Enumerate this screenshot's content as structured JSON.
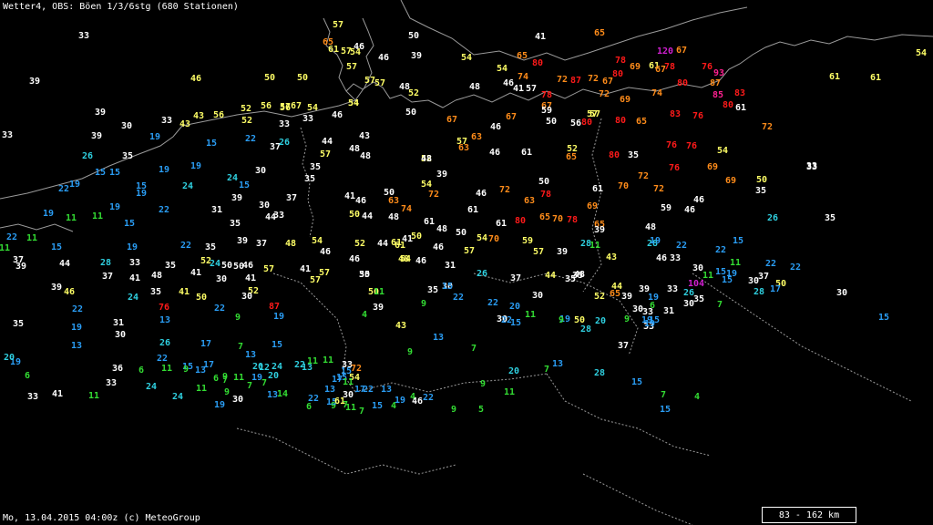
{
  "header": {
    "title": "Wetter4, OBS: Böen 1/3/6stg (680 Stationen)"
  },
  "footer": {
    "text": "Mo, 13.04.2015 04:00z (c) MeteoGroup",
    "scale_label": "83 - 162 km"
  },
  "colors": {
    "background": "#000000",
    "coastline": "#9a9a9a",
    "gust_4_11": "#33dd33",
    "gust_12_22": "#2a9df4",
    "gust_23_28": "#2fd0e0",
    "gust_29_41": "#ffffff",
    "gust_42_57": "#ffff66",
    "gust_58_74": "#ff8c1a",
    "gust_75_90": "#ff1a1a",
    "gust_91_110": "#ff2090",
    "gust_over_110": "#d020d0"
  },
  "stations": [
    {
      "v": "33",
      "c": "w"
    },
    {
      "v": "39",
      "c": "w"
    },
    {
      "v": "46",
      "c": "y"
    },
    {
      "v": "50",
      "c": "y"
    },
    {
      "v": "50",
      "c": "y"
    },
    {
      "v": "57",
      "c": "y"
    },
    {
      "v": "65",
      "c": "o"
    },
    {
      "v": "61",
      "c": "y"
    },
    {
      "v": "57",
      "c": "y"
    },
    {
      "v": "54",
      "c": "y"
    },
    {
      "v": "46",
      "c": "w"
    },
    {
      "v": "46",
      "c": "w"
    },
    {
      "v": "50",
      "c": "w"
    },
    {
      "v": "39",
      "c": "w"
    },
    {
      "v": "41",
      "c": "w"
    },
    {
      "v": "65",
      "c": "o"
    },
    {
      "v": "54",
      "c": "y"
    },
    {
      "v": "57",
      "c": "y"
    },
    {
      "v": "54",
      "c": "y"
    },
    {
      "v": "65",
      "c": "o"
    },
    {
      "v": "80",
      "c": "r"
    },
    {
      "v": "54",
      "c": "y"
    },
    {
      "v": "120",
      "c": "p"
    },
    {
      "v": "67",
      "c": "o"
    },
    {
      "v": "78",
      "c": "r"
    },
    {
      "v": "61",
      "c": "y"
    },
    {
      "v": "57",
      "c": "y"
    },
    {
      "v": "57",
      "c": "y"
    },
    {
      "v": "54",
      "c": "y"
    },
    {
      "v": "48",
      "c": "w"
    },
    {
      "v": "52",
      "c": "y"
    },
    {
      "v": "48",
      "c": "w"
    },
    {
      "v": "46",
      "c": "w"
    },
    {
      "v": "41",
      "c": "w"
    },
    {
      "v": "57",
      "c": "w"
    },
    {
      "v": "74",
      "c": "o"
    },
    {
      "v": "72",
      "c": "o"
    },
    {
      "v": "87",
      "c": "r"
    },
    {
      "v": "72",
      "c": "o"
    },
    {
      "v": "67",
      "c": "o"
    },
    {
      "v": "80",
      "c": "r"
    },
    {
      "v": "69",
      "c": "o"
    },
    {
      "v": "78",
      "c": "r"
    },
    {
      "v": "67",
      "c": "o"
    },
    {
      "v": "76",
      "c": "r"
    },
    {
      "v": "93",
      "c": "m"
    },
    {
      "v": "87",
      "c": "o"
    },
    {
      "v": "80",
      "c": "r"
    },
    {
      "v": "61",
      "c": "y"
    },
    {
      "v": "61",
      "c": "y"
    },
    {
      "v": "57",
      "c": "y"
    },
    {
      "v": "78",
      "c": "r"
    },
    {
      "v": "67",
      "c": "o"
    },
    {
      "v": "59",
      "c": "w"
    },
    {
      "v": "72",
      "c": "o"
    },
    {
      "v": "69",
      "c": "o"
    },
    {
      "v": "74",
      "c": "o"
    },
    {
      "v": "85",
      "c": "m"
    },
    {
      "v": "83",
      "c": "r"
    },
    {
      "v": "80",
      "c": "r"
    },
    {
      "v": "61",
      "c": "w"
    },
    {
      "v": "39",
      "c": "w"
    },
    {
      "v": "33",
      "c": "w"
    },
    {
      "v": "43",
      "c": "y"
    },
    {
      "v": "56",
      "c": "y"
    },
    {
      "v": "52",
      "c": "y"
    },
    {
      "v": "56",
      "c": "y"
    },
    {
      "v": "57",
      "c": "y"
    },
    {
      "v": "67",
      "c": "y"
    },
    {
      "v": "54",
      "c": "y"
    },
    {
      "v": "50",
      "c": "w"
    },
    {
      "v": "67",
      "c": "o"
    },
    {
      "v": "46",
      "c": "w"
    },
    {
      "v": "67",
      "c": "o"
    },
    {
      "v": "50",
      "c": "w"
    },
    {
      "v": "57",
      "c": "y"
    },
    {
      "v": "56",
      "c": "w"
    },
    {
      "v": "80",
      "c": "r"
    },
    {
      "v": "80",
      "c": "r"
    },
    {
      "v": "65",
      "c": "o"
    },
    {
      "v": "83",
      "c": "r"
    },
    {
      "v": "76",
      "c": "r"
    },
    {
      "v": "72",
      "c": "o"
    },
    {
      "v": "33",
      "c": "w"
    },
    {
      "v": "39",
      "c": "w"
    },
    {
      "v": "43",
      "c": "y"
    },
    {
      "v": "52",
      "c": "y"
    },
    {
      "v": "33",
      "c": "w"
    },
    {
      "v": "56",
      "c": "y"
    },
    {
      "v": "46",
      "c": "w"
    },
    {
      "v": "54",
      "c": "y"
    },
    {
      "v": "33",
      "c": "w"
    },
    {
      "v": "30",
      "c": "w"
    },
    {
      "v": "19",
      "c": "b"
    },
    {
      "v": "15",
      "c": "b"
    },
    {
      "v": "22",
      "c": "b"
    },
    {
      "v": "37",
      "c": "w"
    },
    {
      "v": "26",
      "c": "c"
    },
    {
      "v": "43",
      "c": "w"
    },
    {
      "v": "44",
      "c": "w"
    },
    {
      "v": "57",
      "c": "y"
    },
    {
      "v": "48",
      "c": "w"
    },
    {
      "v": "52",
      "c": "y"
    },
    {
      "v": "48",
      "c": "w"
    },
    {
      "v": "57",
      "c": "y"
    },
    {
      "v": "63",
      "c": "o"
    },
    {
      "v": "46",
      "c": "w"
    },
    {
      "v": "61",
      "c": "w"
    },
    {
      "v": "52",
      "c": "y"
    },
    {
      "v": "65",
      "c": "o"
    },
    {
      "v": "80",
      "c": "r"
    },
    {
      "v": "35",
      "c": "w"
    },
    {
      "v": "76",
      "c": "r"
    },
    {
      "v": "76",
      "c": "r"
    },
    {
      "v": "54",
      "c": "y"
    },
    {
      "v": "69",
      "c": "o"
    },
    {
      "v": "33",
      "c": "w"
    },
    {
      "v": "26",
      "c": "c"
    },
    {
      "v": "15",
      "c": "b"
    },
    {
      "v": "15",
      "c": "b"
    },
    {
      "v": "35",
      "c": "w"
    },
    {
      "v": "19",
      "c": "b"
    },
    {
      "v": "19",
      "c": "b"
    },
    {
      "v": "24",
      "c": "c"
    },
    {
      "v": "30",
      "c": "w"
    },
    {
      "v": "35",
      "c": "w"
    },
    {
      "v": "48",
      "c": "w"
    },
    {
      "v": "39",
      "c": "w"
    },
    {
      "v": "63",
      "c": "o"
    },
    {
      "v": "50",
      "c": "w"
    },
    {
      "v": "61",
      "c": "w"
    },
    {
      "v": "70",
      "c": "o"
    },
    {
      "v": "72",
      "c": "o"
    },
    {
      "v": "72",
      "c": "o"
    },
    {
      "v": "76",
      "c": "r"
    },
    {
      "v": "46",
      "c": "w"
    },
    {
      "v": "69",
      "c": "o"
    },
    {
      "v": "50",
      "c": "y"
    },
    {
      "v": "35",
      "c": "w"
    },
    {
      "v": "33",
      "c": "w"
    },
    {
      "v": "22",
      "c": "b"
    },
    {
      "v": "19",
      "c": "b"
    },
    {
      "v": "15",
      "c": "b"
    },
    {
      "v": "24",
      "c": "c"
    },
    {
      "v": "15",
      "c": "b"
    },
    {
      "v": "19",
      "c": "b"
    },
    {
      "v": "39",
      "c": "w"
    },
    {
      "v": "30",
      "c": "w"
    },
    {
      "v": "37",
      "c": "w"
    },
    {
      "v": "35",
      "c": "w"
    },
    {
      "v": "41",
      "c": "w"
    },
    {
      "v": "46",
      "c": "w"
    },
    {
      "v": "50",
      "c": "w"
    },
    {
      "v": "63",
      "c": "o"
    },
    {
      "v": "54",
      "c": "y"
    },
    {
      "v": "72",
      "c": "o"
    },
    {
      "v": "46",
      "c": "w"
    },
    {
      "v": "72",
      "c": "o"
    },
    {
      "v": "63",
      "c": "o"
    },
    {
      "v": "78",
      "c": "r"
    },
    {
      "v": "65",
      "c": "o"
    },
    {
      "v": "61",
      "c": "w"
    },
    {
      "v": "69",
      "c": "o"
    },
    {
      "v": "59",
      "c": "w"
    },
    {
      "v": "46",
      "c": "w"
    },
    {
      "v": "26",
      "c": "c"
    },
    {
      "v": "19",
      "c": "b"
    },
    {
      "v": "11",
      "c": "g"
    },
    {
      "v": "11",
      "c": "g"
    },
    {
      "v": "19",
      "c": "b"
    },
    {
      "v": "15",
      "c": "b"
    },
    {
      "v": "22",
      "c": "b"
    },
    {
      "v": "31",
      "c": "w"
    },
    {
      "v": "35",
      "c": "w"
    },
    {
      "v": "33",
      "c": "w"
    },
    {
      "v": "44",
      "c": "w"
    },
    {
      "v": "50",
      "c": "y"
    },
    {
      "v": "44",
      "c": "w"
    },
    {
      "v": "48",
      "c": "w"
    },
    {
      "v": "74",
      "c": "o"
    },
    {
      "v": "41",
      "c": "w"
    },
    {
      "v": "61",
      "c": "y"
    },
    {
      "v": "50",
      "c": "y"
    },
    {
      "v": "61",
      "c": "w"
    },
    {
      "v": "80",
      "c": "r"
    },
    {
      "v": "61",
      "c": "w"
    },
    {
      "v": "70",
      "c": "o"
    },
    {
      "v": "78",
      "c": "r"
    },
    {
      "v": "65",
      "c": "o"
    },
    {
      "v": "48",
      "c": "w"
    },
    {
      "v": "28",
      "c": "c"
    },
    {
      "v": "35",
      "c": "w"
    },
    {
      "v": "11",
      "c": "g"
    },
    {
      "v": "22",
      "c": "b"
    },
    {
      "v": "11",
      "c": "g"
    },
    {
      "v": "15",
      "c": "b"
    },
    {
      "v": "19",
      "c": "b"
    },
    {
      "v": "22",
      "c": "b"
    },
    {
      "v": "35",
      "c": "w"
    },
    {
      "v": "39",
      "c": "w"
    },
    {
      "v": "37",
      "c": "w"
    },
    {
      "v": "48",
      "c": "y"
    },
    {
      "v": "54",
      "c": "y"
    },
    {
      "v": "46",
      "c": "w"
    },
    {
      "v": "52",
      "c": "y"
    },
    {
      "v": "44",
      "c": "w"
    },
    {
      "v": "61",
      "c": "y"
    },
    {
      "v": "54",
      "c": "y"
    },
    {
      "v": "46",
      "c": "w"
    },
    {
      "v": "48",
      "c": "w"
    },
    {
      "v": "50",
      "c": "w"
    },
    {
      "v": "57",
      "c": "y"
    },
    {
      "v": "70",
      "c": "o"
    },
    {
      "v": "54",
      "c": "y"
    },
    {
      "v": "59",
      "c": "y"
    },
    {
      "v": "57",
      "c": "y"
    },
    {
      "v": "39",
      "c": "w"
    },
    {
      "v": "28",
      "c": "c"
    },
    {
      "v": "39",
      "c": "w"
    },
    {
      "v": "11",
      "c": "g"
    },
    {
      "v": "19",
      "c": "b"
    },
    {
      "v": "22",
      "c": "b"
    },
    {
      "v": "22",
      "c": "b"
    },
    {
      "v": "15",
      "c": "b"
    },
    {
      "v": "37",
      "c": "w"
    },
    {
      "v": "39",
      "c": "w"
    },
    {
      "v": "44",
      "c": "w"
    },
    {
      "v": "28",
      "c": "c"
    },
    {
      "v": "33",
      "c": "w"
    },
    {
      "v": "35",
      "c": "w"
    },
    {
      "v": "52",
      "c": "y"
    },
    {
      "v": "50",
      "c": "w"
    },
    {
      "v": "46",
      "c": "w"
    },
    {
      "v": "57",
      "c": "y"
    },
    {
      "v": "41",
      "c": "w"
    },
    {
      "v": "57",
      "c": "y"
    },
    {
      "v": "46",
      "c": "w"
    },
    {
      "v": "35",
      "c": "w"
    },
    {
      "v": "48",
      "c": "y"
    },
    {
      "v": "31",
      "c": "w"
    },
    {
      "v": "46",
      "c": "w"
    },
    {
      "v": "44",
      "c": "y"
    },
    {
      "v": "35",
      "c": "w"
    },
    {
      "v": "43",
      "c": "y"
    },
    {
      "v": "46",
      "c": "w"
    },
    {
      "v": "33",
      "c": "w"
    },
    {
      "v": "30",
      "c": "w"
    },
    {
      "v": "11",
      "c": "g"
    },
    {
      "v": "15",
      "c": "b"
    },
    {
      "v": "11",
      "c": "g"
    },
    {
      "v": "22",
      "c": "b"
    },
    {
      "v": "22",
      "c": "b"
    },
    {
      "v": "37",
      "c": "w"
    },
    {
      "v": "39",
      "c": "w"
    },
    {
      "v": "41",
      "c": "w"
    },
    {
      "v": "48",
      "c": "w"
    },
    {
      "v": "41",
      "c": "w"
    },
    {
      "v": "24",
      "c": "c"
    },
    {
      "v": "50",
      "c": "w"
    },
    {
      "v": "30",
      "c": "w"
    },
    {
      "v": "41",
      "c": "w"
    },
    {
      "v": "57",
      "c": "y"
    },
    {
      "v": "50",
      "c": "w"
    },
    {
      "v": "35",
      "c": "w"
    },
    {
      "v": "50",
      "c": "y"
    },
    {
      "v": "30",
      "c": "w"
    },
    {
      "v": "26",
      "c": "c"
    },
    {
      "v": "37",
      "c": "w"
    },
    {
      "v": "48",
      "c": "w"
    },
    {
      "v": "35",
      "c": "w"
    },
    {
      "v": "44",
      "c": "y"
    },
    {
      "v": "39",
      "c": "w"
    },
    {
      "v": "33",
      "c": "w"
    },
    {
      "v": "26",
      "c": "c"
    },
    {
      "v": "104",
      "c": "p"
    },
    {
      "v": "19",
      "c": "b"
    },
    {
      "v": "15",
      "c": "b"
    },
    {
      "v": "30",
      "c": "w"
    },
    {
      "v": "37",
      "c": "w"
    },
    {
      "v": "30",
      "c": "w"
    },
    {
      "v": "46",
      "c": "y"
    },
    {
      "v": "24",
      "c": "c"
    },
    {
      "v": "35",
      "c": "w"
    },
    {
      "v": "41",
      "c": "y"
    },
    {
      "v": "50",
      "c": "y"
    },
    {
      "v": "52",
      "c": "y"
    },
    {
      "v": "30",
      "c": "w"
    },
    {
      "v": "11",
      "c": "g"
    },
    {
      "v": "15",
      "c": "b"
    },
    {
      "v": "22",
      "c": "b"
    },
    {
      "v": "20",
      "c": "b"
    },
    {
      "v": "30",
      "c": "w"
    },
    {
      "v": "52",
      "c": "y"
    },
    {
      "v": "65",
      "c": "o"
    },
    {
      "v": "39",
      "c": "w"
    },
    {
      "v": "19",
      "c": "b"
    },
    {
      "v": "30",
      "c": "w"
    },
    {
      "v": "31",
      "c": "w"
    },
    {
      "v": "30",
      "c": "w"
    },
    {
      "v": "35",
      "c": "w"
    },
    {
      "v": "28",
      "c": "c"
    },
    {
      "v": "50",
      "c": "y"
    },
    {
      "v": "17",
      "c": "b"
    },
    {
      "v": "7",
      "c": "g"
    },
    {
      "v": "15",
      "c": "b"
    },
    {
      "v": "22",
      "c": "b"
    },
    {
      "v": "35",
      "c": "w"
    },
    {
      "v": "76",
      "c": "r"
    },
    {
      "v": "22",
      "c": "b"
    },
    {
      "v": "87",
      "c": "r"
    },
    {
      "v": "39",
      "c": "w"
    },
    {
      "v": "9",
      "c": "g"
    },
    {
      "v": "22",
      "c": "b"
    },
    {
      "v": "30",
      "c": "w"
    },
    {
      "v": "15",
      "c": "b"
    },
    {
      "v": "11",
      "c": "g"
    },
    {
      "v": "19",
      "c": "b"
    },
    {
      "v": "20",
      "c": "c"
    },
    {
      "v": "28",
      "c": "c"
    },
    {
      "v": "33",
      "c": "w"
    },
    {
      "v": "33",
      "c": "w"
    },
    {
      "v": "19",
      "c": "b"
    },
    {
      "v": "31",
      "c": "w"
    },
    {
      "v": "13",
      "c": "b"
    },
    {
      "v": "9",
      "c": "g"
    },
    {
      "v": "19",
      "c": "b"
    },
    {
      "v": "4",
      "c": "g"
    },
    {
      "v": "43",
      "c": "y"
    },
    {
      "v": "22",
      "c": "b"
    },
    {
      "v": "9",
      "c": "g"
    },
    {
      "v": "50",
      "c": "y"
    },
    {
      "v": "19",
      "c": "b"
    },
    {
      "v": "15",
      "c": "b"
    },
    {
      "v": "9",
      "c": "g"
    },
    {
      "v": "6",
      "c": "g"
    },
    {
      "v": "19",
      "c": "b"
    },
    {
      "v": "13",
      "c": "b"
    },
    {
      "v": "30",
      "c": "w"
    },
    {
      "v": "26",
      "c": "c"
    },
    {
      "v": "17",
      "c": "b"
    },
    {
      "v": "7",
      "c": "g"
    },
    {
      "v": "15",
      "c": "b"
    },
    {
      "v": "13",
      "c": "b"
    },
    {
      "v": "7",
      "c": "g"
    },
    {
      "v": "37",
      "c": "w"
    },
    {
      "v": "19",
      "c": "b"
    },
    {
      "v": "20",
      "c": "c"
    },
    {
      "v": "22",
      "c": "b"
    },
    {
      "v": "15",
      "c": "b"
    },
    {
      "v": "13",
      "c": "b"
    },
    {
      "v": "20",
      "c": "c"
    },
    {
      "v": "12",
      "c": "c"
    },
    {
      "v": "24",
      "c": "c"
    },
    {
      "v": "22",
      "c": "c"
    },
    {
      "v": "13",
      "c": "c"
    },
    {
      "v": "11",
      "c": "g"
    },
    {
      "v": "11",
      "c": "g"
    },
    {
      "v": "33",
      "c": "w"
    },
    {
      "v": "72",
      "c": "o"
    },
    {
      "v": "54",
      "c": "y"
    },
    {
      "v": "9",
      "c": "g"
    },
    {
      "v": "20",
      "c": "c"
    },
    {
      "v": "7",
      "c": "g"
    },
    {
      "v": "13",
      "c": "b"
    },
    {
      "v": "28",
      "c": "c"
    },
    {
      "v": "36",
      "c": "w"
    },
    {
      "v": "6",
      "c": "g"
    },
    {
      "v": "11",
      "c": "g"
    },
    {
      "v": "9",
      "c": "g"
    },
    {
      "v": "13",
      "c": "b"
    },
    {
      "v": "17",
      "c": "b"
    },
    {
      "v": "6",
      "c": "g"
    },
    {
      "v": "9",
      "c": "g"
    },
    {
      "v": "11",
      "c": "g"
    },
    {
      "v": "19",
      "c": "b"
    },
    {
      "v": "11",
      "c": "g"
    },
    {
      "v": "7",
      "c": "g"
    },
    {
      "v": "9",
      "c": "g"
    },
    {
      "v": "7",
      "c": "g"
    },
    {
      "v": "14",
      "c": "g"
    },
    {
      "v": "17",
      "c": "b"
    },
    {
      "v": "15",
      "c": "b"
    },
    {
      "v": "17",
      "c": "b"
    },
    {
      "v": "6",
      "c": "g"
    },
    {
      "v": "9",
      "c": "g"
    },
    {
      "v": "15",
      "c": "b"
    },
    {
      "v": "13",
      "c": "b"
    },
    {
      "v": "11",
      "c": "g"
    },
    {
      "v": "22",
      "c": "b"
    },
    {
      "v": "30",
      "c": "w"
    },
    {
      "v": "13",
      "c": "b"
    },
    {
      "v": "4",
      "c": "g"
    },
    {
      "v": "46",
      "c": "w"
    },
    {
      "v": "9",
      "c": "g"
    },
    {
      "v": "15",
      "c": "b"
    },
    {
      "v": "7",
      "c": "g"
    },
    {
      "v": "4",
      "c": "g"
    },
    {
      "v": "6",
      "c": "g"
    },
    {
      "v": "33",
      "c": "w"
    },
    {
      "v": "41",
      "c": "w"
    },
    {
      "v": "11",
      "c": "g"
    },
    {
      "v": "33",
      "c": "w"
    },
    {
      "v": "24",
      "c": "c"
    },
    {
      "v": "24",
      "c": "c"
    },
    {
      "v": "19",
      "c": "b"
    },
    {
      "v": "30",
      "c": "w"
    },
    {
      "v": "7",
      "c": "g"
    },
    {
      "v": "13",
      "c": "b"
    },
    {
      "v": "20",
      "c": "c"
    },
    {
      "v": "22",
      "c": "b"
    },
    {
      "v": "15",
      "c": "b"
    },
    {
      "v": "61",
      "c": "y"
    },
    {
      "v": "11",
      "c": "g"
    },
    {
      "v": "7",
      "c": "g"
    },
    {
      "v": "7",
      "c": "g"
    },
    {
      "v": "15",
      "c": "b"
    },
    {
      "v": "4",
      "c": "g"
    },
    {
      "v": "19",
      "c": "b"
    },
    {
      "v": "22",
      "c": "b"
    },
    {
      "v": "9",
      "c": "g"
    },
    {
      "v": "5",
      "c": "g"
    },
    {
      "v": "11",
      "c": "g"
    },
    {
      "v": "15",
      "c": "b"
    }
  ]
}
